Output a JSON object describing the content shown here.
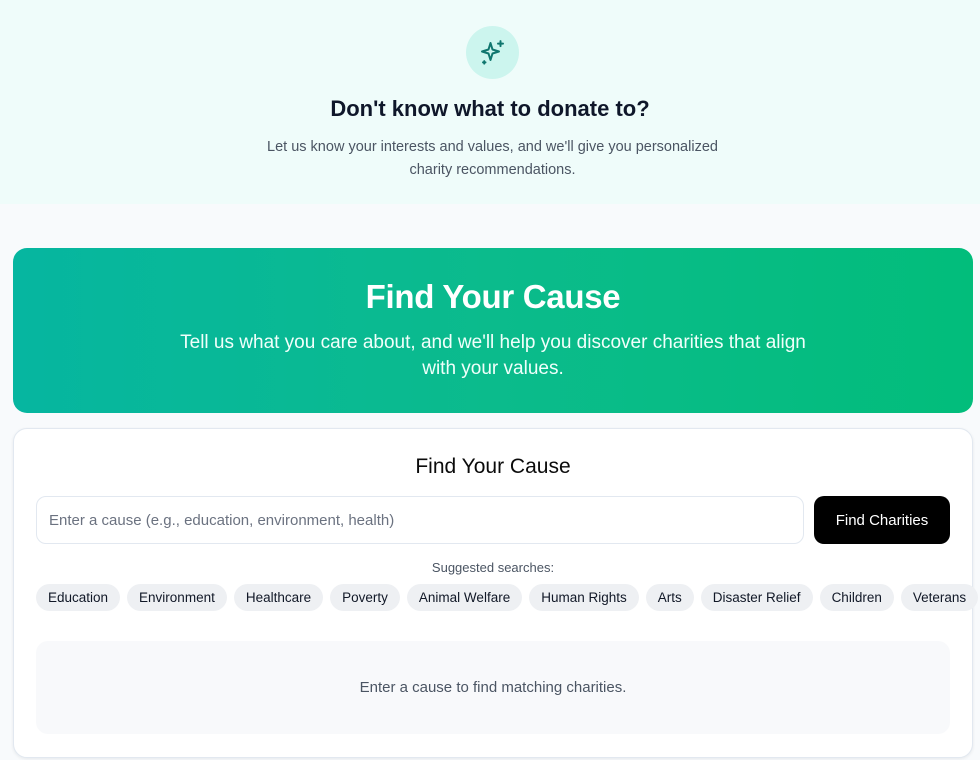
{
  "banner": {
    "icon": "sparkles-icon",
    "title": "Don't know what to donate to?",
    "subtitle": "Let us know your interests and values, and we'll give you personalized charity recommendations."
  },
  "hero": {
    "title": "Find Your Cause",
    "subtitle": "Tell us what you care about, and we'll help you discover charities that align with your values."
  },
  "search_card": {
    "title": "Find Your Cause",
    "input_value": "",
    "input_placeholder": "Enter a cause (e.g., education, environment, health)",
    "button_label": "Find Charities",
    "suggested_label": "Suggested searches:",
    "suggestions": [
      "Education",
      "Environment",
      "Healthcare",
      "Poverty",
      "Animal Welfare",
      "Human Rights",
      "Arts",
      "Disaster Relief",
      "Children",
      "Veterans"
    ],
    "empty_message": "Enter a cause to find matching charities."
  },
  "colors": {
    "accent": "#0bbb8c",
    "accent_start": "#06b6a0",
    "banner_bg": "#effcfa",
    "icon_bg": "#ccf5ee",
    "button_bg": "#000000"
  }
}
